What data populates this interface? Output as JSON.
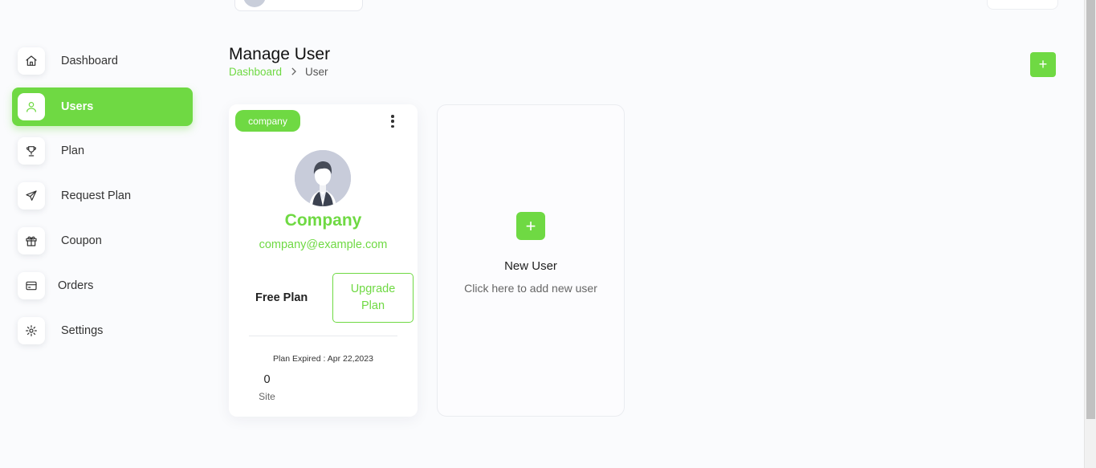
{
  "sidebar": {
    "items": [
      {
        "label": "Dashboard",
        "icon": "home-icon"
      },
      {
        "label": "Users",
        "icon": "user-icon"
      },
      {
        "label": "Plan",
        "icon": "trophy-icon"
      },
      {
        "label": "Request Plan",
        "icon": "send-icon"
      },
      {
        "label": "Coupon",
        "icon": "gift-icon"
      },
      {
        "label": "Orders",
        "icon": "credit-card-icon"
      },
      {
        "label": "Settings",
        "icon": "gear-icon"
      }
    ],
    "active": "Users"
  },
  "header": {
    "title": "Manage User",
    "breadcrumb": {
      "link": "Dashboard",
      "current": "User"
    },
    "add_label": "+"
  },
  "user_card": {
    "role": "company",
    "name": "Company",
    "email": "company@example.com",
    "plan": "Free Plan",
    "upgrade_line1": "Upgrade",
    "upgrade_line2": "Plan",
    "plan_expired": "Plan Expired : Apr 22,2023",
    "site_count": "0",
    "site_label": "Site"
  },
  "new_user_card": {
    "icon_label": "+",
    "title": "New User",
    "description": "Click here to add new user"
  },
  "colors": {
    "accent": "#6fd943",
    "background": "#fafbfd"
  }
}
